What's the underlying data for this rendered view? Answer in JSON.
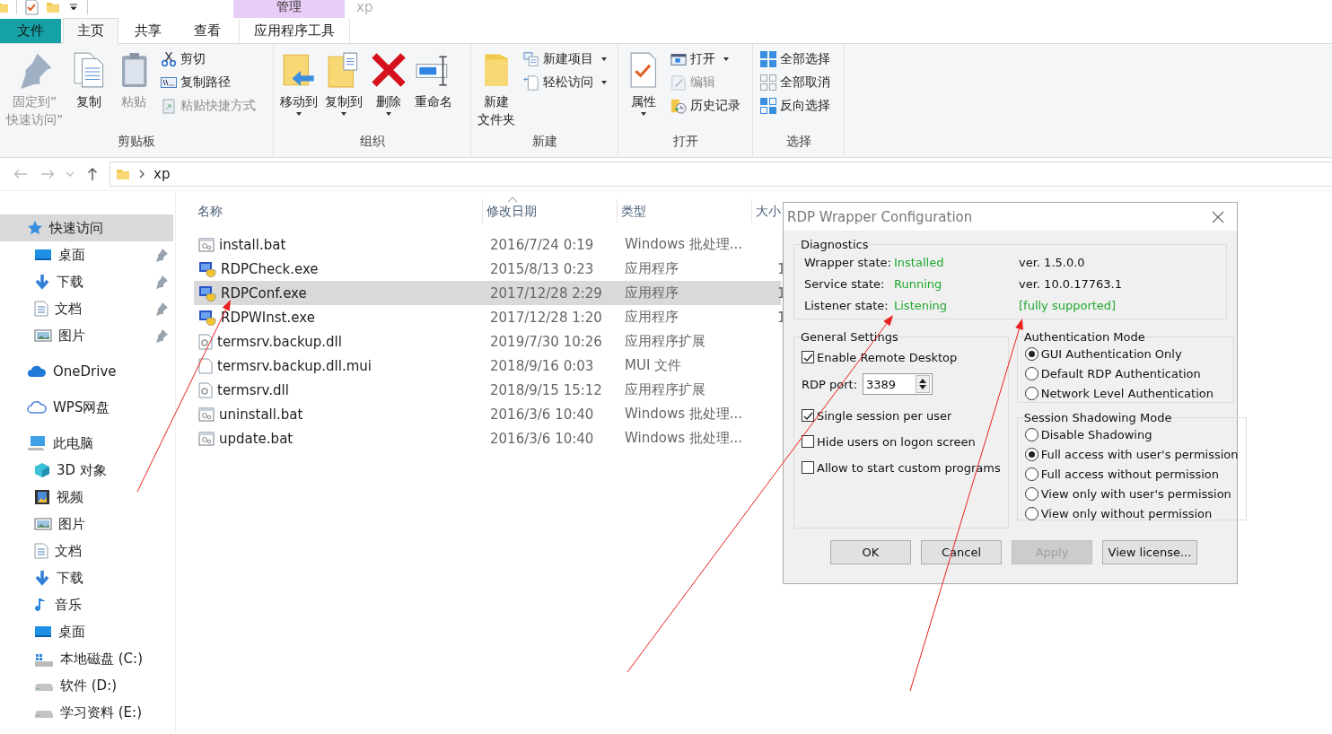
{
  "window": {
    "title": "xp",
    "context_tab_header": "管理"
  },
  "ribbon": {
    "tabs": [
      {
        "label": "文件",
        "kind": "file",
        "selected": false
      },
      {
        "label": "主页",
        "kind": "tab",
        "selected": true
      },
      {
        "label": "共享",
        "kind": "tab",
        "selected": false
      },
      {
        "label": "查看",
        "kind": "tab",
        "selected": false
      },
      {
        "label": "应用程序工具",
        "kind": "context",
        "selected": false
      }
    ],
    "groups": [
      {
        "label": "剪贴板",
        "items": [
          {
            "label_lines": [
              "固定到”",
              "快速访问”"
            ],
            "kind": "large",
            "disabled": true,
            "dropdown": false
          },
          {
            "label": "复制",
            "kind": "large",
            "disabled": false,
            "dropdown": false
          },
          {
            "label": "粘贴",
            "kind": "large",
            "disabled": true,
            "dropdown": false
          },
          {
            "label": "剪切",
            "kind": "small",
            "disabled": false,
            "dropdown": false
          },
          {
            "label": "复制路径",
            "kind": "small",
            "disabled": false,
            "dropdown": false
          },
          {
            "label": "粘贴快捷方式",
            "kind": "small",
            "disabled": true,
            "dropdown": false
          }
        ]
      },
      {
        "label": "组织",
        "items": [
          {
            "label": "移动到",
            "kind": "large",
            "disabled": false,
            "dropdown": true
          },
          {
            "label": "复制到",
            "kind": "large",
            "disabled": false,
            "dropdown": true
          },
          {
            "label": "删除",
            "kind": "large",
            "disabled": false,
            "dropdown": true
          },
          {
            "label": "重命名",
            "kind": "large",
            "disabled": false,
            "dropdown": false
          }
        ]
      },
      {
        "label": "新建",
        "items": [
          {
            "label_lines": [
              "新建",
              "文件夹"
            ],
            "kind": "large",
            "disabled": false,
            "dropdown": false
          },
          {
            "label": "新建项目",
            "kind": "small",
            "disabled": false,
            "dropdown": true
          },
          {
            "label": "轻松访问",
            "kind": "small",
            "disabled": false,
            "dropdown": true
          }
        ]
      },
      {
        "label": "打开",
        "items": [
          {
            "label": "属性",
            "kind": "large",
            "disabled": false,
            "dropdown": true
          },
          {
            "label": "打开",
            "kind": "small",
            "disabled": false,
            "dropdown": true
          },
          {
            "label": "编辑",
            "kind": "small",
            "disabled": true,
            "dropdown": false
          },
          {
            "label": "历史记录",
            "kind": "small",
            "disabled": false,
            "dropdown": false
          }
        ]
      },
      {
        "label": "选择",
        "items": [
          {
            "label": "全部选择",
            "kind": "small",
            "disabled": false,
            "dropdown": false
          },
          {
            "label": "全部取消",
            "kind": "small",
            "disabled": false,
            "dropdown": false
          },
          {
            "label": "反向选择",
            "kind": "small",
            "disabled": false,
            "dropdown": false
          }
        ]
      }
    ]
  },
  "address_bar": {
    "path": [
      "xp"
    ]
  },
  "sidebar": {
    "items": [
      {
        "label": "快速访问",
        "selected": true,
        "children": [
          {
            "label": "桌面",
            "selected": false,
            "pinned": true
          },
          {
            "label": "下载",
            "selected": false,
            "pinned": true
          },
          {
            "label": "文档",
            "selected": false,
            "pinned": true
          },
          {
            "label": "图片",
            "selected": false,
            "pinned": true
          }
        ]
      },
      {
        "label": "OneDrive",
        "selected": false
      },
      {
        "label": "WPS网盘",
        "selected": false
      },
      {
        "label": "此电脑",
        "selected": false,
        "children": [
          {
            "label": "3D 对象",
            "selected": false
          },
          {
            "label": "视频",
            "selected": false
          },
          {
            "label": "图片",
            "selected": false
          },
          {
            "label": "文档",
            "selected": false
          },
          {
            "label": "下载",
            "selected": false
          },
          {
            "label": "音乐",
            "selected": false
          },
          {
            "label": "桌面",
            "selected": false
          },
          {
            "label": "本地磁盘 (C:)",
            "selected": false
          },
          {
            "label": "软件 (D:)",
            "selected": false
          },
          {
            "label": "学习资料 (E:)",
            "selected": false
          }
        ]
      }
    ]
  },
  "file_list": {
    "columns": [
      "名称",
      "修改日期",
      "类型",
      "大小"
    ],
    "rows": [
      {
        "kind": "batch",
        "name": "install.bat",
        "date": "2016/7/24 0:19",
        "type": "Windows 批处理...",
        "selected": false
      },
      {
        "kind": "app",
        "name": "RDPCheck.exe",
        "date": "2015/8/13 0:23",
        "type": "应用程序",
        "size": "1",
        "selected": false
      },
      {
        "kind": "app",
        "name": "RDPConf.exe",
        "date": "2017/12/28 2:29",
        "type": "应用程序",
        "size": "1",
        "selected": true
      },
      {
        "kind": "app",
        "name": "RDPWInst.exe",
        "date": "2017/12/28 1:20",
        "type": "应用程序",
        "size": "1",
        "selected": false
      },
      {
        "kind": "extension",
        "name": "termsrv.backup.dll",
        "date": "2019/7/30 10:26",
        "type": "应用程序扩展",
        "selected": false
      },
      {
        "kind": "file",
        "name": "termsrv.backup.dll.mui",
        "date": "2018/9/16 0:03",
        "type": "MUI 文件",
        "selected": false
      },
      {
        "kind": "extension",
        "name": "termsrv.dll",
        "date": "2018/9/15 15:12",
        "type": "应用程序扩展",
        "selected": false
      },
      {
        "kind": "batch",
        "name": "uninstall.bat",
        "date": "2016/3/6 10:40",
        "type": "Windows 批处理...",
        "selected": false
      },
      {
        "kind": "batch",
        "name": "update.bat",
        "date": "2016/3/6 10:40",
        "type": "Windows 批处理...",
        "selected": false
      }
    ]
  },
  "dialog": {
    "title": "RDP Wrapper Configuration",
    "diagnostics": {
      "title": "Diagnostics",
      "rows": [
        {
          "label": "Wrapper state:",
          "value": "Installed",
          "info": "ver.  1.5.0.0",
          "info_ok": false
        },
        {
          "label": "Service state:",
          "value": "Running",
          "info": "ver.  10.0.17763.1",
          "info_ok": false
        },
        {
          "label": "Listener state:",
          "value": "Listening",
          "info": "[fully supported]",
          "info_ok": true
        }
      ]
    },
    "general_settings": {
      "title": "General Settings",
      "items": [
        {
          "kind": "checkbox",
          "label": "Enable Remote Desktop",
          "checked": true
        },
        {
          "kind": "spin",
          "label": "RDP port:",
          "value": "3389"
        },
        {
          "kind": "checkbox",
          "label": "Single session per user",
          "checked": true
        },
        {
          "kind": "checkbox",
          "label": "Hide users on logon screen",
          "checked": false
        },
        {
          "kind": "checkbox",
          "label": "Allow to start custom programs",
          "checked": false
        }
      ]
    },
    "authentication_mode": {
      "title": "Authentication Mode",
      "options": [
        {
          "label": "GUI Authentication Only",
          "selected": true
        },
        {
          "label": "Default RDP Authentication",
          "selected": false
        },
        {
          "label": "Network Level Authentication",
          "selected": false
        }
      ]
    },
    "session_shadowing_mode": {
      "title": "Session Shadowing Mode",
      "options": [
        {
          "label": "Disable Shadowing",
          "selected": false
        },
        {
          "label": "Full access with user's permission",
          "selected": true
        },
        {
          "label": "Full access without permission",
          "selected": false
        },
        {
          "label": "View only with user's permission",
          "selected": false
        },
        {
          "label": "View only without permission",
          "selected": false
        }
      ]
    },
    "buttons": [
      {
        "label": "OK",
        "disabled": false
      },
      {
        "label": "Cancel",
        "disabled": false
      },
      {
        "label": "Apply",
        "disabled": true
      },
      {
        "label": "View license...",
        "disabled": false
      }
    ]
  }
}
